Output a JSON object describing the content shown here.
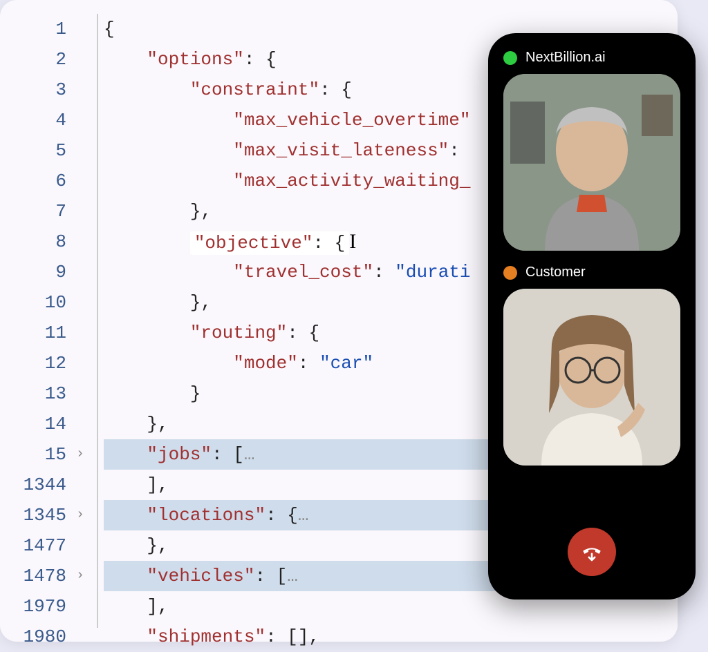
{
  "editor": {
    "lines": [
      {
        "num": "1",
        "folded": false,
        "fold_toggle": false,
        "indent": 0,
        "tokens": [
          {
            "t": "punct",
            "v": "{"
          }
        ]
      },
      {
        "num": "2",
        "folded": false,
        "fold_toggle": false,
        "indent": 1,
        "tokens": [
          {
            "t": "key",
            "v": "\"options\""
          },
          {
            "t": "punct",
            "v": ": {"
          }
        ]
      },
      {
        "num": "3",
        "folded": false,
        "fold_toggle": false,
        "indent": 2,
        "tokens": [
          {
            "t": "key",
            "v": "\"constraint\""
          },
          {
            "t": "punct",
            "v": ": {"
          }
        ]
      },
      {
        "num": "4",
        "folded": false,
        "fold_toggle": false,
        "indent": 3,
        "tokens": [
          {
            "t": "key",
            "v": "\"max_vehicle_overtime\""
          }
        ]
      },
      {
        "num": "5",
        "folded": false,
        "fold_toggle": false,
        "indent": 3,
        "tokens": [
          {
            "t": "key",
            "v": "\"max_visit_lateness\""
          },
          {
            "t": "punct",
            "v": ":"
          }
        ]
      },
      {
        "num": "6",
        "folded": false,
        "fold_toggle": false,
        "indent": 3,
        "tokens": [
          {
            "t": "key",
            "v": "\"max_activity_waiting_"
          }
        ]
      },
      {
        "num": "7",
        "folded": false,
        "fold_toggle": false,
        "indent": 2,
        "tokens": [
          {
            "t": "punct",
            "v": "},"
          }
        ]
      },
      {
        "num": "8",
        "folded": false,
        "fold_toggle": false,
        "indent": 2,
        "highlight": true,
        "tokens": [
          {
            "t": "key",
            "v": "\"objective\""
          },
          {
            "t": "punct",
            "v": ": {"
          }
        ],
        "cursor": true
      },
      {
        "num": "9",
        "folded": false,
        "fold_toggle": false,
        "indent": 3,
        "tokens": [
          {
            "t": "key",
            "v": "\"travel_cost\""
          },
          {
            "t": "punct",
            "v": ": "
          },
          {
            "t": "str",
            "v": "\"durati"
          }
        ]
      },
      {
        "num": "10",
        "folded": false,
        "fold_toggle": false,
        "indent": 2,
        "tokens": [
          {
            "t": "punct",
            "v": "},"
          }
        ]
      },
      {
        "num": "11",
        "folded": false,
        "fold_toggle": false,
        "indent": 2,
        "tokens": [
          {
            "t": "key",
            "v": "\"routing\""
          },
          {
            "t": "punct",
            "v": ": {"
          }
        ]
      },
      {
        "num": "12",
        "folded": false,
        "fold_toggle": false,
        "indent": 3,
        "tokens": [
          {
            "t": "key",
            "v": "\"mode\""
          },
          {
            "t": "punct",
            "v": ": "
          },
          {
            "t": "str",
            "v": "\"car\""
          }
        ]
      },
      {
        "num": "13",
        "folded": false,
        "fold_toggle": false,
        "indent": 2,
        "tokens": [
          {
            "t": "punct",
            "v": "}"
          }
        ]
      },
      {
        "num": "14",
        "folded": false,
        "fold_toggle": false,
        "indent": 1,
        "tokens": [
          {
            "t": "punct",
            "v": "},"
          }
        ]
      },
      {
        "num": "15",
        "folded": true,
        "fold_toggle": true,
        "indent": 1,
        "tokens": [
          {
            "t": "key",
            "v": "\"jobs\""
          },
          {
            "t": "punct",
            "v": ": ["
          },
          {
            "t": "fold",
            "v": "…"
          }
        ]
      },
      {
        "num": "1344",
        "folded": false,
        "fold_toggle": false,
        "indent": 1,
        "tokens": [
          {
            "t": "punct",
            "v": "],"
          }
        ]
      },
      {
        "num": "1345",
        "folded": true,
        "fold_toggle": true,
        "indent": 1,
        "tokens": [
          {
            "t": "key",
            "v": "\"locations\""
          },
          {
            "t": "punct",
            "v": ": {"
          },
          {
            "t": "fold",
            "v": "…"
          }
        ]
      },
      {
        "num": "1477",
        "folded": false,
        "fold_toggle": false,
        "indent": 1,
        "tokens": [
          {
            "t": "punct",
            "v": "},"
          }
        ]
      },
      {
        "num": "1478",
        "folded": true,
        "fold_toggle": true,
        "indent": 1,
        "tokens": [
          {
            "t": "key",
            "v": "\"vehicles\""
          },
          {
            "t": "punct",
            "v": ": ["
          },
          {
            "t": "fold",
            "v": "…"
          }
        ]
      },
      {
        "num": "1979",
        "folded": false,
        "fold_toggle": false,
        "indent": 1,
        "tokens": [
          {
            "t": "punct",
            "v": "],"
          }
        ]
      },
      {
        "num": "1980",
        "folded": false,
        "fold_toggle": false,
        "indent": 1,
        "tokens": [
          {
            "t": "key",
            "v": "\"shipments\""
          },
          {
            "t": "punct",
            "v": ": [],"
          }
        ]
      }
    ]
  },
  "call": {
    "participants": [
      {
        "name": "NextBillion.ai",
        "dot": "green"
      },
      {
        "name": "Customer",
        "dot": "orange"
      }
    ],
    "hangup_label": "Hang up"
  }
}
